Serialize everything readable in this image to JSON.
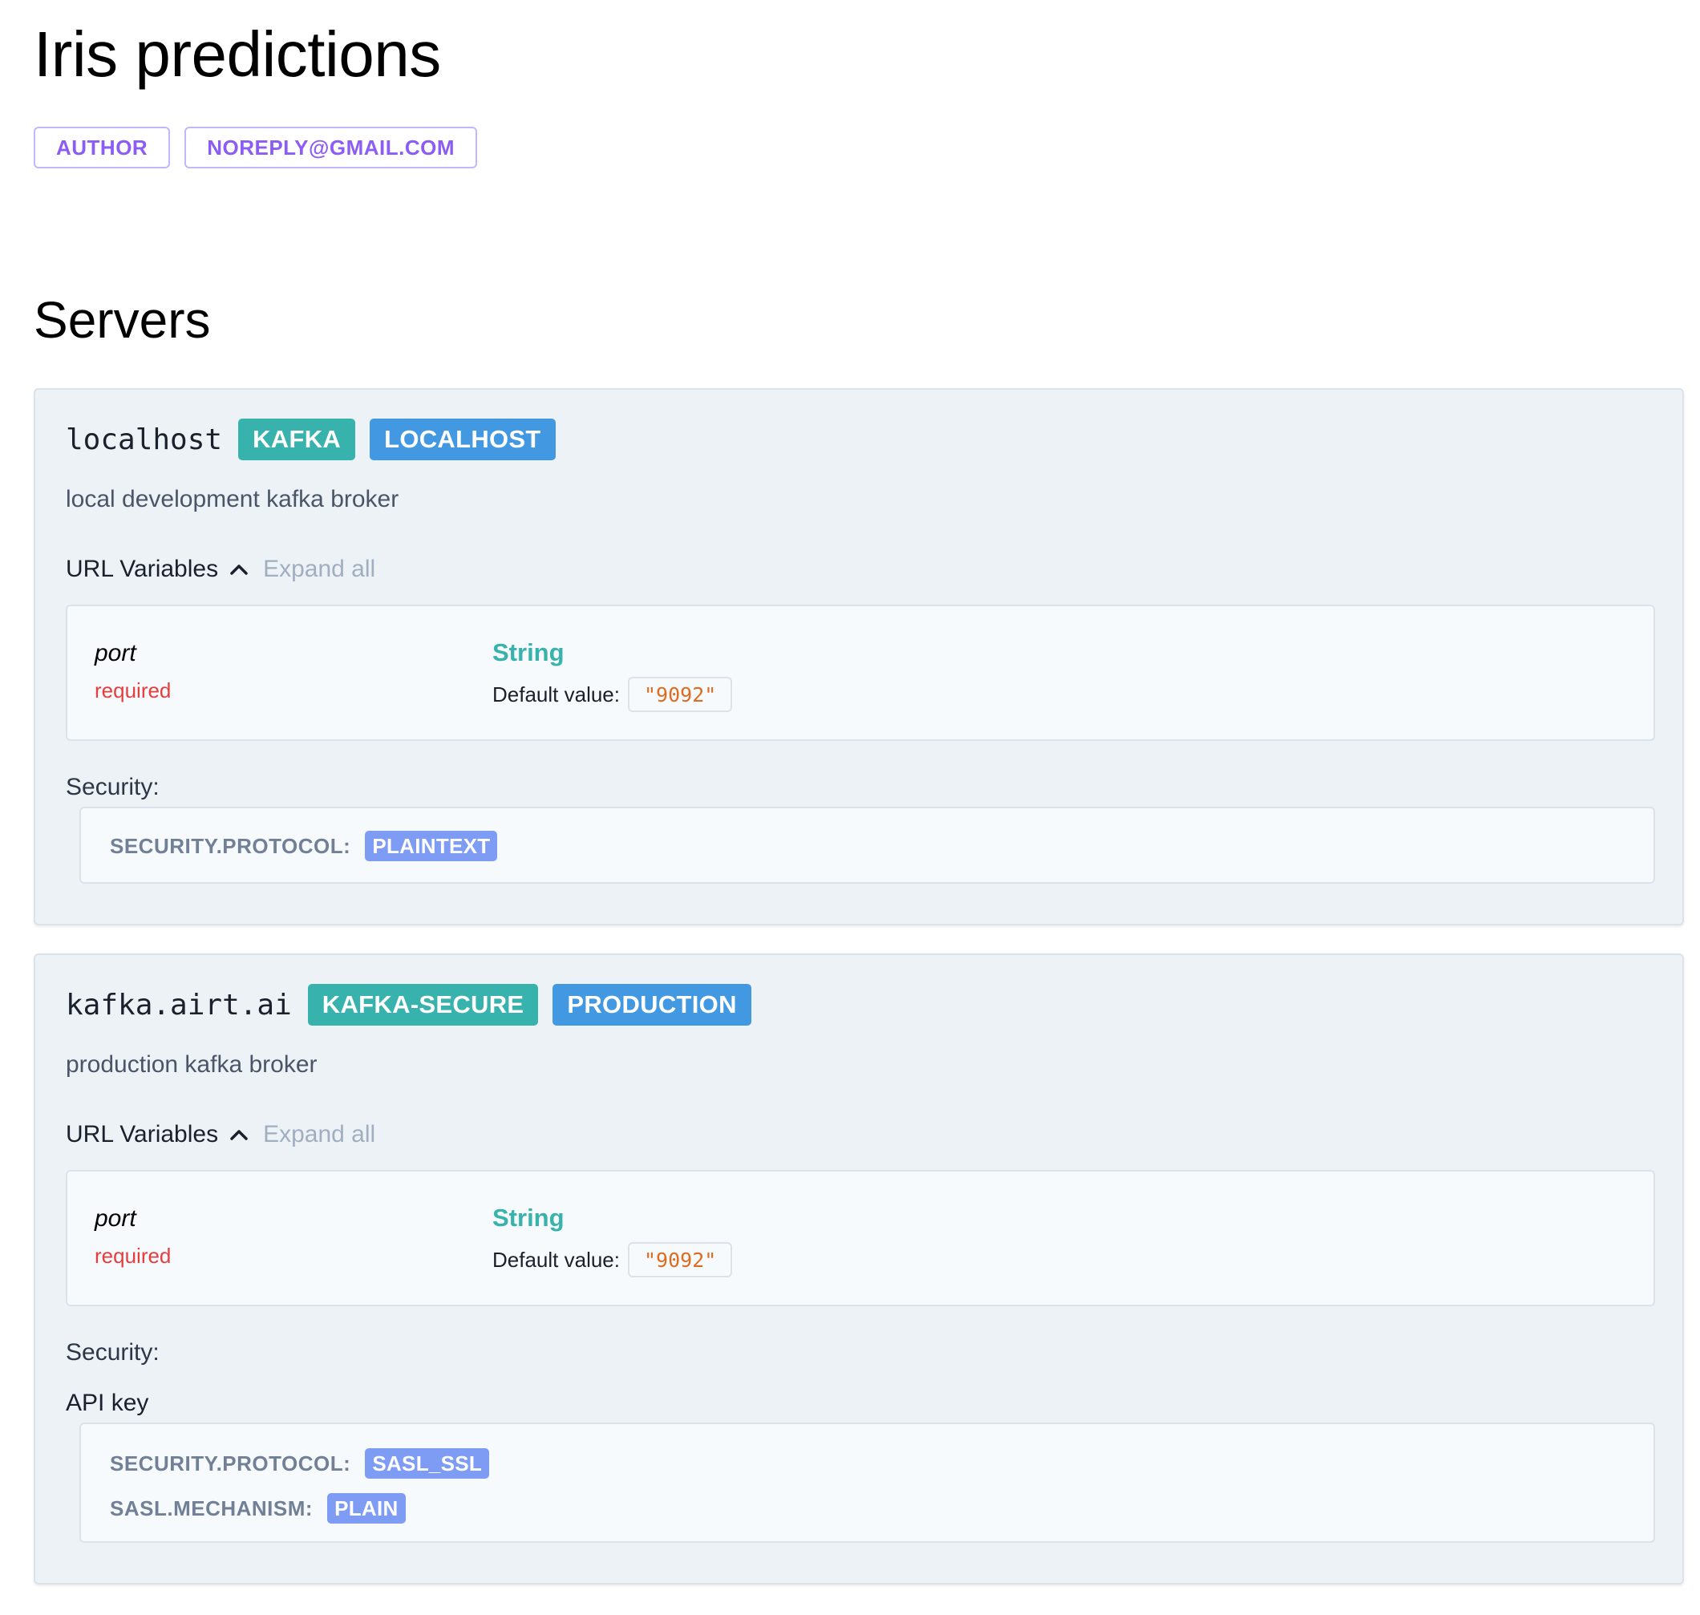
{
  "page_title": "Iris predictions",
  "author_tags": [
    "AUTHOR",
    "NOREPLY@GMAIL.COM"
  ],
  "servers_title": "Servers",
  "servers": [
    {
      "url": "localhost",
      "protocol_badge": "KAFKA",
      "env_badge": "LOCALHOST",
      "description": "local development kafka broker",
      "url_variables_label": "URL Variables",
      "expand_all_label": "Expand all",
      "variable": {
        "name": "port",
        "required_label": "required",
        "type": "String",
        "default_label": "Default value:",
        "default_value": "\"9092\""
      },
      "security_label": "Security:",
      "security_items": [
        {
          "key": "SECURITY.PROTOCOL:",
          "value": "PLAINTEXT"
        }
      ]
    },
    {
      "url": "kafka.airt.ai",
      "protocol_badge": "KAFKA-SECURE",
      "env_badge": "PRODUCTION",
      "description": "production kafka broker",
      "url_variables_label": "URL Variables",
      "expand_all_label": "Expand all",
      "variable": {
        "name": "port",
        "required_label": "required",
        "type": "String",
        "default_label": "Default value:",
        "default_value": "\"9092\""
      },
      "security_label": "Security:",
      "security_scheme": "API key",
      "security_items": [
        {
          "key": "SECURITY.PROTOCOL:",
          "value": "SASL_SSL"
        },
        {
          "key": "SASL.MECHANISM:",
          "value": "PLAIN"
        }
      ]
    }
  ],
  "icons": {
    "url_vars_toggle": "chevron-up-icon"
  },
  "colors": {
    "tag_outline": "#8b5cf6",
    "badge_teal": "#38b2ac",
    "badge_blue": "#4299e1",
    "security_value": "#7f9cf5",
    "required": "#e53e3e",
    "default_value": "#dd6b20"
  }
}
